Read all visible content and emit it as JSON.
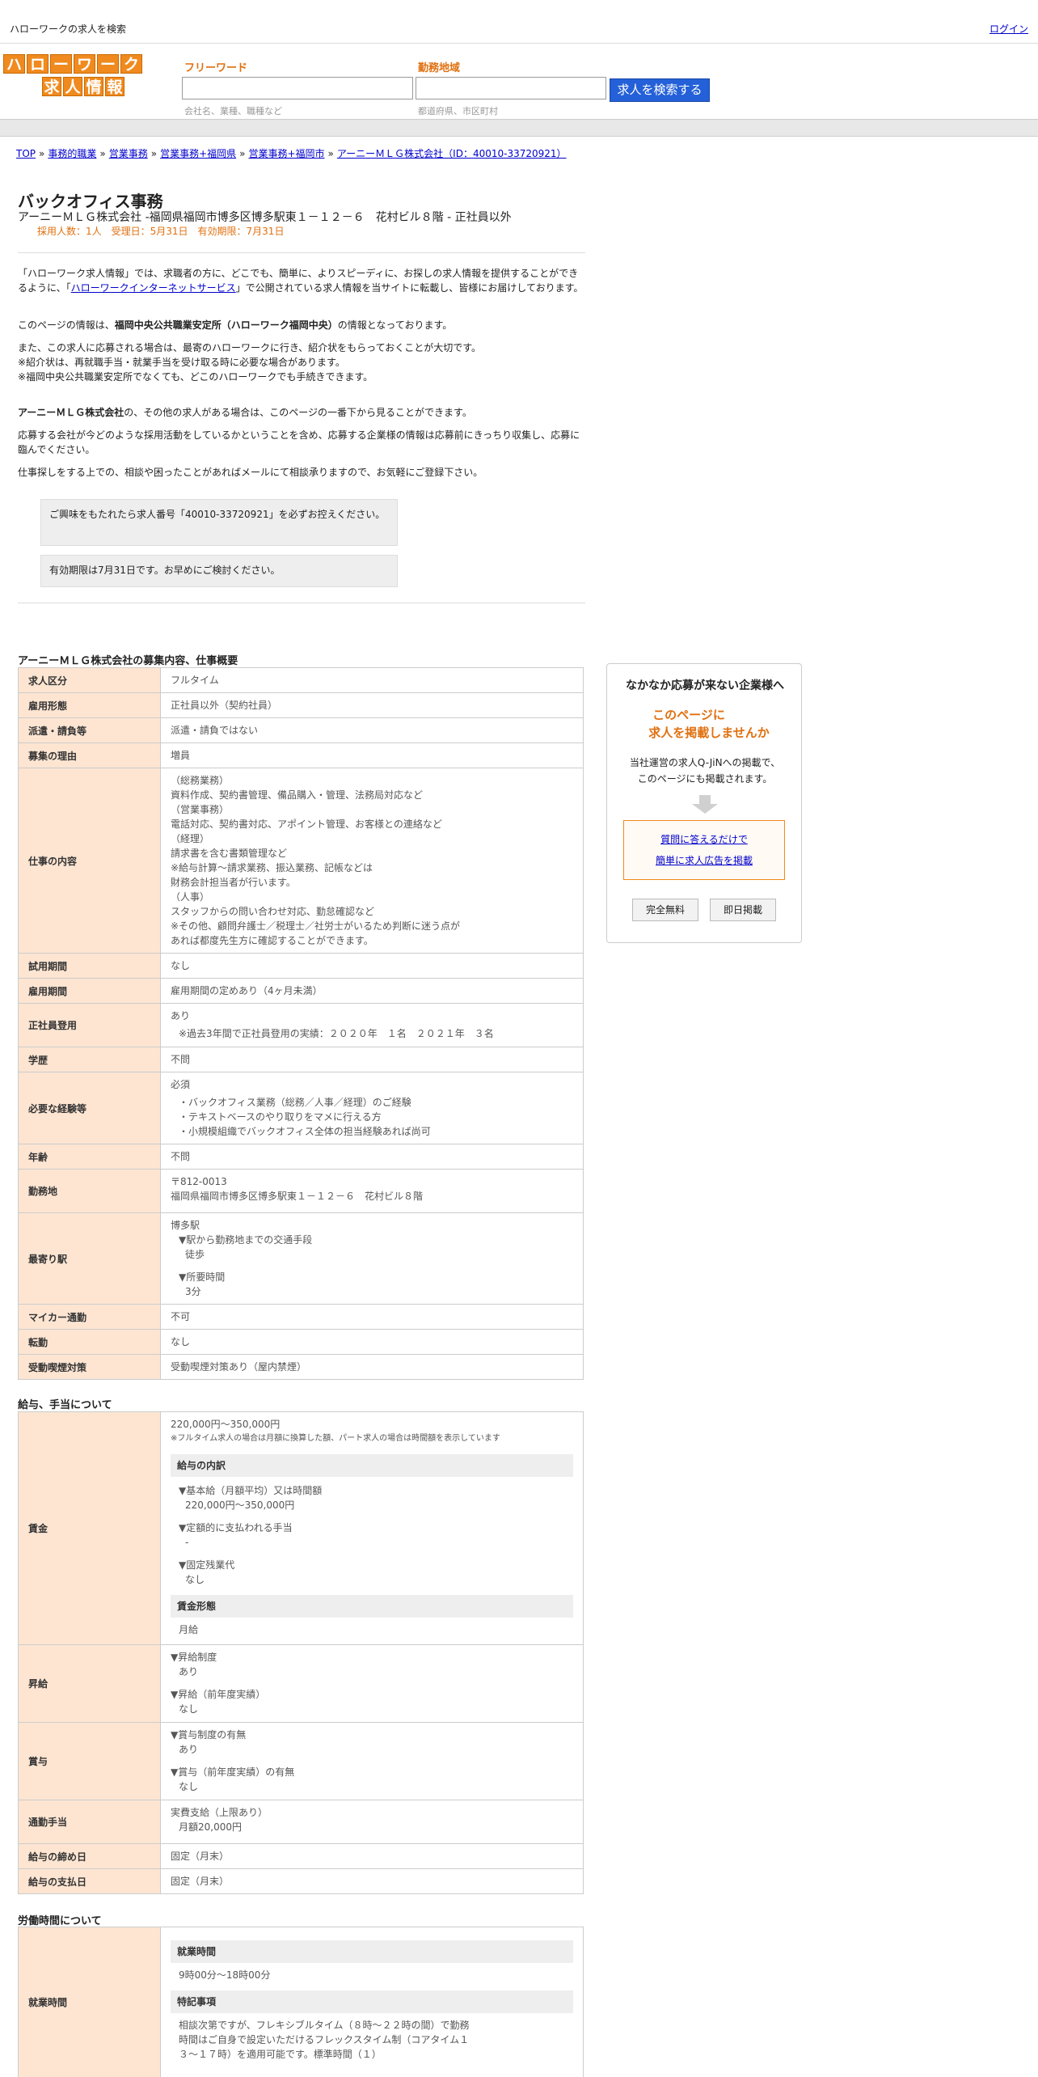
{
  "top": {
    "site_title": "ハローワークの求人を検索",
    "login": "ログイン"
  },
  "logo": {
    "row1": [
      "ハ",
      "ロ",
      "ー",
      "ワ",
      "ー",
      "ク"
    ],
    "row2": [
      "求",
      "人",
      "情",
      "報"
    ]
  },
  "search": {
    "freeword_label": "フリーワード",
    "freeword_placeholder": "会社名、業種、職種など",
    "area_label": "勤務地域",
    "area_placeholder": "都道府県、市区町村",
    "button": "求人を検索する"
  },
  "breadcrumb": [
    "TOP",
    "事務的職業",
    "営業事務",
    "営業事務+福岡県",
    "営業事務+福岡市",
    "アーニーＭＬＧ株式会社（ID：40010-33720921）"
  ],
  "breadcrumb_sep": "»",
  "job": {
    "title": "バックオフィス事務",
    "subtitle": "アーニーＭＬＧ株式会社 -福岡県福岡市博多区博多駅東１－１２－６　花村ビル８階 - 正社員以外",
    "meta": "採用人数：1人　受理日：5月31日　有効期限：7月31日"
  },
  "intro": {
    "p1a": "「ハローワーク求人情報」では、求職者の方に、どこでも、簡単に、よりスピーディに、お探しの求人情報を提供することができるように、「",
    "p1link": "ハローワークインターネットサービス",
    "p1b": "」で公開されている求人情報を当サイトに転載し、皆様にお届けしております。",
    "p2a": "このページの情報は、",
    "p2b": "福岡中央公共職業安定所（ハローワーク福岡中央）",
    "p2c": "の情報となっております。",
    "p3": [
      "また、この求人に応募される場合は、最寄のハローワークに行き、紹介状をもらっておくことが大切です。",
      "※紹介状は、再就職手当・就業手当を受け取る時に必要な場合があります。",
      "※福岡中央公共職業安定所でなくても、どこのハローワークでも手続きできます。"
    ],
    "p4a": "アーニーＭＬＧ株式会社",
    "p4b": "の、その他の求人がある場合は、このページの一番下から見ることができます。",
    "p5": "応募する会社が今どのような採用活動をしているかということを含め、応募する企業様の情報は応募前にきっちり収集し、応募に臨んでください。",
    "p6": "仕事探しをする上での、相談や困ったことがあればメールにて相談承りますので、お気軽にご登録下さい。",
    "note1": "ご興味をもたれたら求人番号「40010-33720921」を必ずお控えください。",
    "note2": "有効期限は7月31日です。お早めにご検討ください。"
  },
  "sections": {
    "overview": "アーニーＭＬＧ株式会社の募集内容、仕事概要",
    "pay": "給与、手当について",
    "hours": "労働時間について"
  },
  "overview_rows": [
    {
      "label": "求人区分",
      "lines": [
        "フルタイム"
      ]
    },
    {
      "label": "雇用形態",
      "lines": [
        "正社員以外（契約社員）"
      ]
    },
    {
      "label": "派遣・請負等",
      "lines": [
        "派遣・請負ではない"
      ]
    },
    {
      "label": "募集の理由",
      "lines": [
        "増員"
      ]
    },
    {
      "label": "仕事の内容",
      "lines": [
        "（総務業務）",
        "資料作成、契約書管理、備品購入・管理、法務局対応など",
        "（営業事務）",
        "電話対応、契約書対応、アポイント管理、お客様との連絡など",
        "（経理）",
        "請求書を含む書類管理など",
        "※給与計算～請求業務、振込業務、記帳などは",
        "財務会計担当者が行います。",
        "（人事）",
        "スタッフからの問い合わせ対応、勤怠確認など",
        "※その他、顧問弁護士／税理士／社労士がいるため判断に迷う点が",
        "あれば都度先生方に確認することができます。"
      ]
    },
    {
      "label": "試用期間",
      "lines": [
        "なし"
      ]
    },
    {
      "label": "雇用期間",
      "lines": [
        "雇用期間の定めあり（4ヶ月未満）"
      ]
    },
    {
      "label": "正社員登用",
      "lines": [
        "あり"
      ],
      "ind": [
        "※過去3年間で正社員登用の実績：２０２０年　１名　２０２１年　３名"
      ]
    },
    {
      "label": "学歴",
      "lines": [
        "不問"
      ]
    },
    {
      "label": "必要な経験等",
      "lines": [
        "必須"
      ],
      "ind": [
        "・バックオフィス業務（総務／人事／経理）のご経験",
        "・テキストベースのやり取りをマメに行える方",
        "・小規模組織でバックオフィス全体の担当経験あれば尚可"
      ]
    },
    {
      "label": "年齢",
      "lines": [
        "不問"
      ]
    },
    {
      "label": "勤務地",
      "lines": [
        "〒812-0013",
        "福岡県福岡市博多区博多駅東１－１２－６　花村ビル８階"
      ]
    },
    {
      "label": "最寄り駅",
      "lines": [
        "博多駅"
      ],
      "station": {
        "h1": "▼駅から勤務地までの交通手段",
        "v1": "徒歩",
        "h2": "▼所要時間",
        "v2": "3分"
      }
    },
    {
      "label": "マイカー通勤",
      "lines": [
        "不可"
      ]
    },
    {
      "label": "転勤",
      "lines": [
        "なし"
      ]
    },
    {
      "label": "受動喫煙対策",
      "lines": [
        "受動喫煙対策あり（屋内禁煙）"
      ]
    }
  ],
  "pay": {
    "wage_label": "賃金",
    "wage_range": "220,000円〜350,000円",
    "wage_note": "※フルタイム求人の場合は月額に換算した額、パート求人の場合は時間額を表示しています",
    "breakdown_title": "給与の内訳",
    "base_h": "▼基本給（月額平均）又は時間額",
    "base_v": "220,000円〜350,000円",
    "fixed_h": "▼定額的に支払われる手当",
    "fixed_v": "-",
    "ot_h": "▼固定残業代",
    "ot_v": "なし",
    "form_title": "賃金形態",
    "form_v": "月給",
    "raise_label": "昇給",
    "raise_h1": "▼昇給制度",
    "raise_v1": "あり",
    "raise_h2": "▼昇給（前年度実績）",
    "raise_v2": "なし",
    "bonus_label": "賞与",
    "bonus_h1": "▼賞与制度の有無",
    "bonus_v1": "あり",
    "bonus_h2": "▼賞与（前年度実績）の有無",
    "bonus_v2": "なし",
    "commute_label": "通勤手当",
    "commute_v1": "実費支給（上限あり）",
    "commute_v2": "月額20,000円",
    "close_label": "給与の締め日",
    "close_v": "固定（月末）",
    "paydate_label": "給与の支払日",
    "paydate_v": "固定（月末）"
  },
  "hours": {
    "label": "就業時間",
    "t1": "就業時間",
    "v1": "9時00分〜18時00分",
    "t2": "特記事項",
    "v2": [
      "相談次第ですが、フレキシブルタイム（８時～２２時の間）で勤務",
      "時間はご自身で設定いただけるフレックスタイム制（コアタイム１",
      "３～１７時）を適用可能です。標準時間（１）"
    ]
  },
  "ad": {
    "heading": "なかなか応募が来ない企業様へ",
    "offer1": "このページに",
    "offer2": "求人を掲載しませんか",
    "desc1": "当社運営の求人Q-JiNへの掲載で、",
    "desc2": "このページにも掲載されます。",
    "link1": "質問に答えるだけで",
    "link2": "簡単に求人広告を掲載",
    "badge1": "完全無料",
    "badge2": "即日掲載"
  },
  "colors": {
    "accent": "#e07010",
    "button": "#2460d8",
    "th_bg": "#fde5d2"
  }
}
